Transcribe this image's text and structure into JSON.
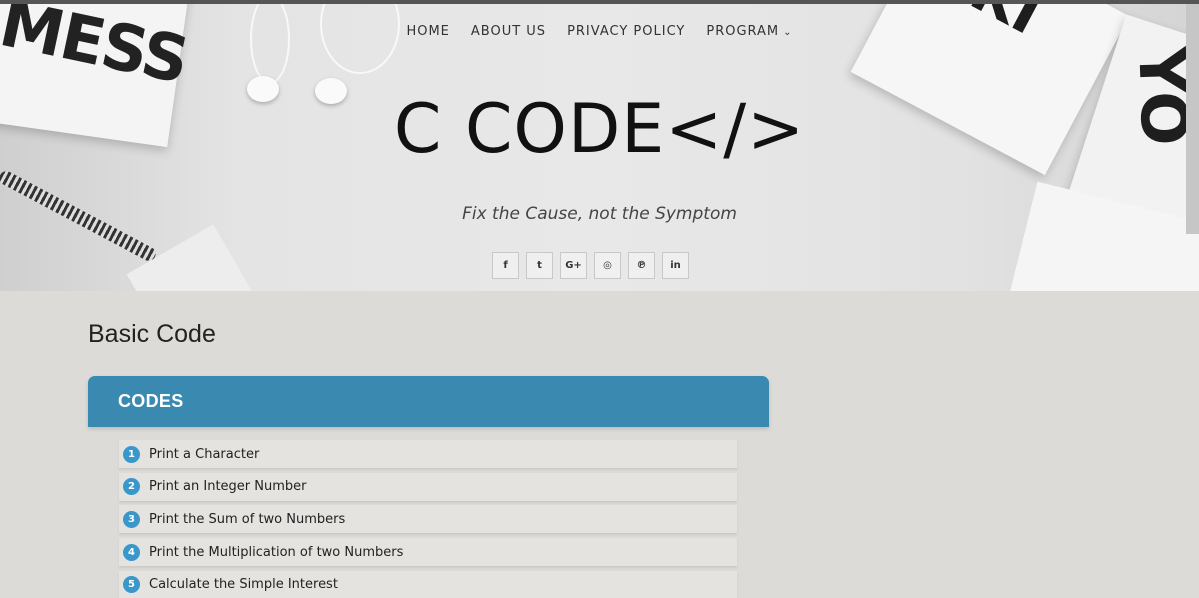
{
  "hero": {
    "deco_text_left": "MESS",
    "deco_text_right": "KI",
    "deco_text_right2": "YO"
  },
  "nav": {
    "items": [
      "HOME",
      "ABOUT US",
      "PRIVACY POLICY",
      "PROGRAM"
    ],
    "program_chevron": "chevron-down-icon"
  },
  "site": {
    "logo": "C CODE</>",
    "tagline": "Fix the Cause, not the Symptom"
  },
  "social": [
    {
      "icon": "facebook-icon",
      "glyph": "f"
    },
    {
      "icon": "twitter-icon",
      "glyph": "t"
    },
    {
      "icon": "google-plus-icon",
      "glyph": "G+"
    },
    {
      "icon": "instagram-icon",
      "glyph": "◎"
    },
    {
      "icon": "pinterest-icon",
      "glyph": "℗"
    },
    {
      "icon": "linkedin-icon",
      "glyph": "in"
    }
  ],
  "main": {
    "page_title": "Basic Code",
    "panel_title": "CODES",
    "items": [
      {
        "num": "1",
        "label": "Print a Character"
      },
      {
        "num": "2",
        "label": "Print an Integer Number"
      },
      {
        "num": "3",
        "label": "Print the Sum of two Numbers"
      },
      {
        "num": "4",
        "label": "Print the Multiplication of two Numbers"
      },
      {
        "num": "5",
        "label": "Calculate the Simple Interest"
      }
    ]
  },
  "colors": {
    "accent": "#3a89b1",
    "badge": "#3a97c9",
    "page_bg": "#dcdbd8"
  }
}
